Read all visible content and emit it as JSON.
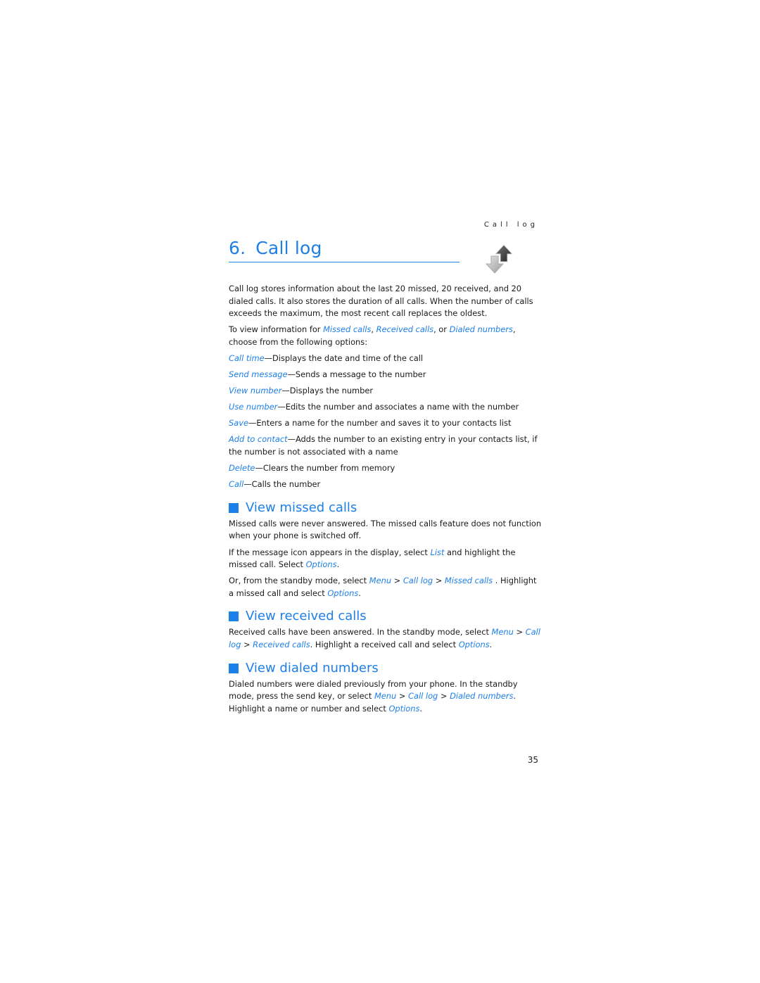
{
  "running_head": "Call log",
  "chapter": {
    "number": "6.",
    "title": "Call log",
    "icon": "call-log-arrows-icon"
  },
  "intro": {
    "p1": "Call log stores information about the last 20 missed, 20 received, and 20 dialed calls. It also stores the duration of all calls. When the number of calls exceeds the maximum, the most recent call replaces the oldest.",
    "p2_pre": "To view information for ",
    "p2_link1": "Missed calls",
    "p2_sep1": ", ",
    "p2_link2": "Received calls",
    "p2_sep2": ", or ",
    "p2_link3": "Dialed numbers",
    "p2_post": ", choose from the following options:"
  },
  "options": [
    {
      "term": "Call time",
      "desc": "—Displays the date and time of the call"
    },
    {
      "term": "Send message",
      "desc": "—Sends a message to the number"
    },
    {
      "term": "View number",
      "desc": "—Displays the number"
    },
    {
      "term": "Use number",
      "desc": "—Edits the number and associates a name with the number"
    },
    {
      "term": "Save",
      "desc": "—Enters a name for the number and saves it to your contacts list"
    },
    {
      "term": "Add to contact",
      "desc": "—Adds the number to an existing entry in your contacts list, if the number is not associated with a name"
    },
    {
      "term": "Delete",
      "desc": "—Clears the number from memory"
    },
    {
      "term": "Call",
      "desc": "—Calls the number"
    }
  ],
  "missed": {
    "heading": "View missed calls",
    "p1": "Missed calls were never answered. The missed calls feature does not function when your phone is switched off.",
    "p2_pre": "If the message icon appears in the display, select ",
    "p2_link1": "List",
    "p2_mid": " and highlight the missed call. Select ",
    "p2_link2": "Options",
    "p2_post": ".",
    "p3_pre": "Or, from the standby mode, select ",
    "p3_link1": "Menu",
    "p3_sep1": " > ",
    "p3_link2": "Call log",
    "p3_sep2": " > ",
    "p3_link3": "Missed calls",
    "p3_mid": " . Highlight a missed call and select ",
    "p3_link4": "Options",
    "p3_post": "."
  },
  "received": {
    "heading": "View received calls",
    "p1_pre": "Received calls have been answered. In the standby mode, select ",
    "p1_link1": "Menu",
    "p1_sep1": " > ",
    "p1_link2": "Call log",
    "p1_sep2": " > ",
    "p1_link3": "Received calls",
    "p1_mid": ". Highlight a received call and select ",
    "p1_link4": "Options",
    "p1_post": "."
  },
  "dialed": {
    "heading": "View dialed numbers",
    "p1_pre": "Dialed numbers were dialed previously from your phone. In the standby mode, press the send key, or select ",
    "p1_link1": "Menu",
    "p1_sep1": " > ",
    "p1_link2": "Call log",
    "p1_sep2": " > ",
    "p1_link3": "Dialed numbers",
    "p1_mid": ". Highlight a name or number and select ",
    "p1_link4": "Options",
    "p1_post": "."
  },
  "page_number": "35"
}
